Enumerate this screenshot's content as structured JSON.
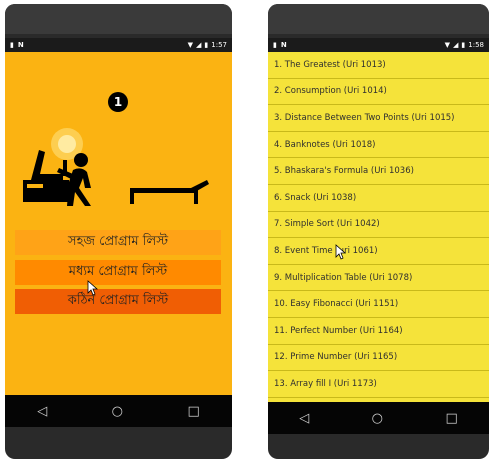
{
  "left_phone": {
    "status": {
      "time": "1:57",
      "left_icons": [
        "sd-card-icon",
        "n-icon"
      ],
      "right_icons": [
        "wifi-icon",
        "signal-icon",
        "battery-icon"
      ]
    },
    "step_number": "1",
    "colors": {
      "background": "#fbb312",
      "button_easy": "#ffa317",
      "button_medium": "#ff8a00",
      "button_hard": "#f05e04"
    },
    "buttons": [
      {
        "label": "সহজ প্রোগ্রাম লিস্ট"
      },
      {
        "label": "মধ্যম প্রোগ্রাম লিস্ট"
      },
      {
        "label": "কঠিন প্রোগ্রাম লিস্ট"
      }
    ],
    "nav": {
      "back": "◁",
      "home": "○",
      "recents": "□"
    }
  },
  "right_phone": {
    "status": {
      "time": "1:58",
      "left_icons": [
        "sd-card-icon",
        "n-icon"
      ],
      "right_icons": [
        "wifi-icon",
        "signal-icon",
        "battery-icon"
      ]
    },
    "colors": {
      "background": "#f5e33a"
    },
    "problems": [
      "1. The Greatest (Uri 1013)",
      "2. Consumption (Uri 1014)",
      "3. Distance Between Two Points (Uri 1015)",
      "4. Banknotes (Uri 1018)",
      "5. Bhaskara's Formula (Uri 1036)",
      "6. Snack (Uri 1038)",
      "7. Simple Sort (Uri 1042)",
      "8. Event Time (uri 1061)",
      "9. Multiplication Table (Uri 1078)",
      "10. Easy Fibonacci (Uri 1151)",
      "11. Perfect Number (Uri 1164)",
      "12. Prime Number (Uri 1165)",
      "13. Array fill I (Uri 1173)"
    ],
    "nav": {
      "back": "◁",
      "home": "○",
      "recents": "□"
    }
  }
}
